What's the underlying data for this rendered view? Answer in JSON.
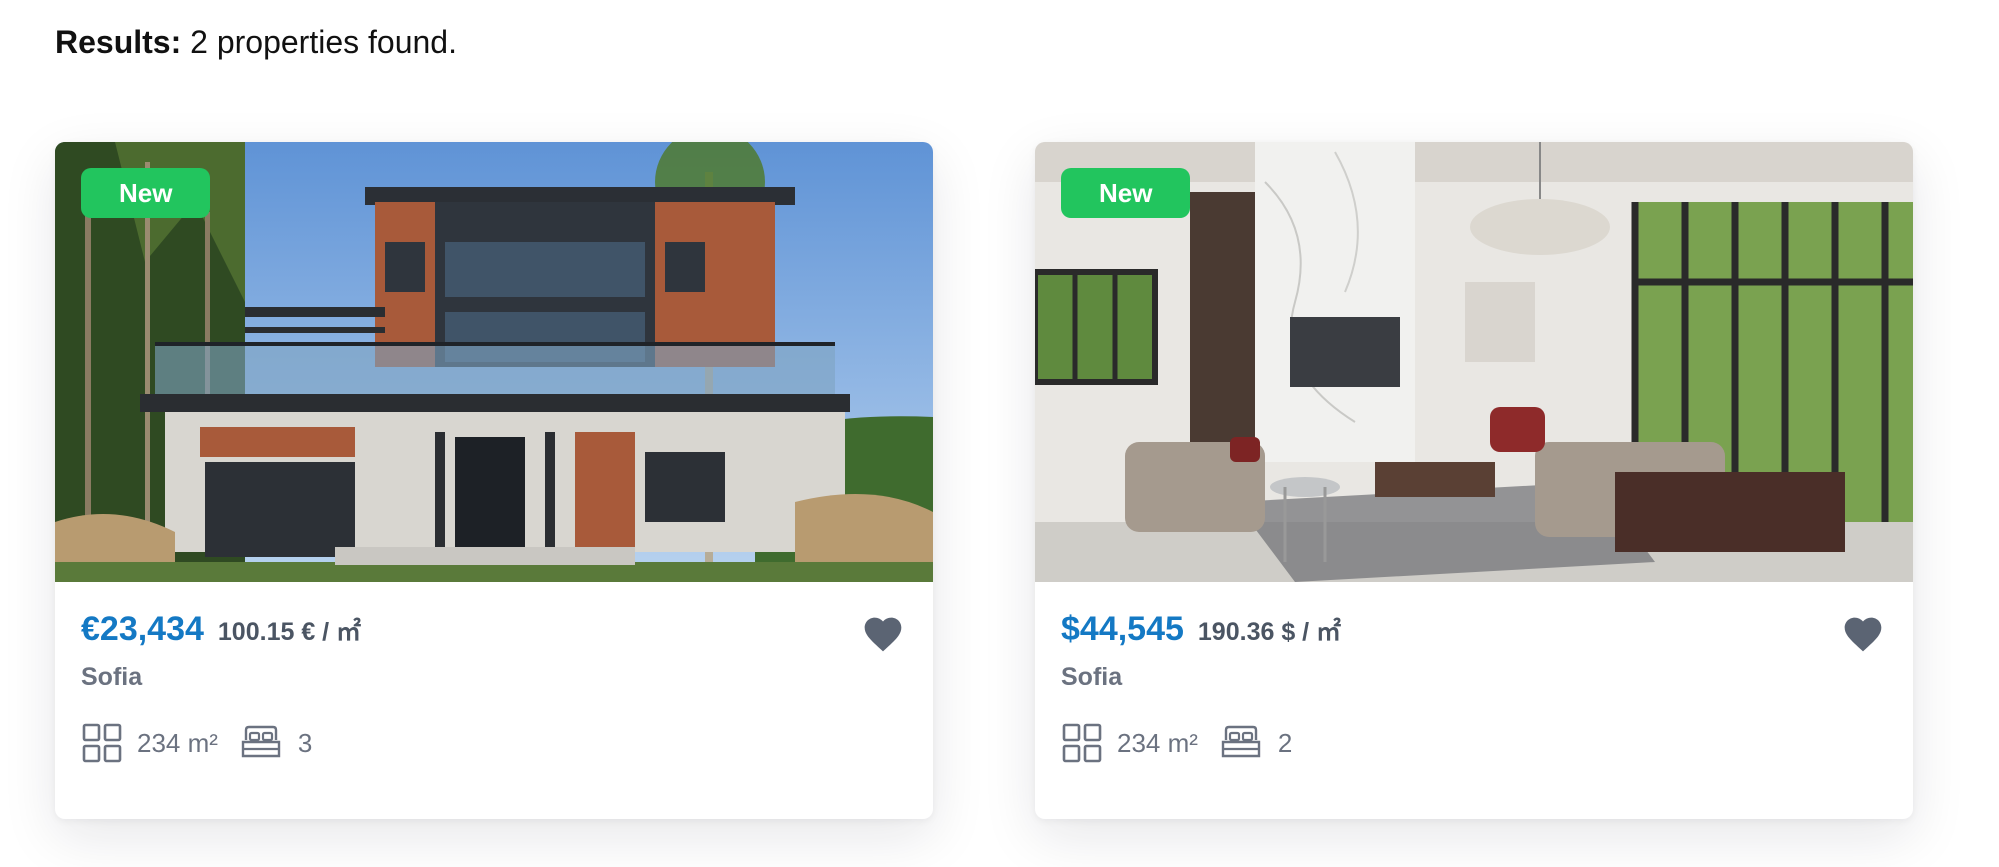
{
  "results": {
    "label": "Results:",
    "text": "2 properties found."
  },
  "listings": [
    {
      "badge": "New",
      "price": "€23,434",
      "price_per_m2": "100.15 € / ㎡",
      "city": "Sofia",
      "area": "234 m²",
      "bedrooms": "3",
      "image": "house-exterior-photo",
      "favorite_icon": "heart-icon"
    },
    {
      "badge": "New",
      "price": "$44,545",
      "price_per_m2": "190.36 $ / ㎡",
      "city": "Sofia",
      "area": "234 m²",
      "bedrooms": "2",
      "image": "living-room-interior-photo",
      "favorite_icon": "heart-icon"
    }
  ],
  "colors": {
    "price": "#1479c4",
    "badge": "#22c55e",
    "muted": "#6b7280",
    "heart": "#5b6473"
  }
}
